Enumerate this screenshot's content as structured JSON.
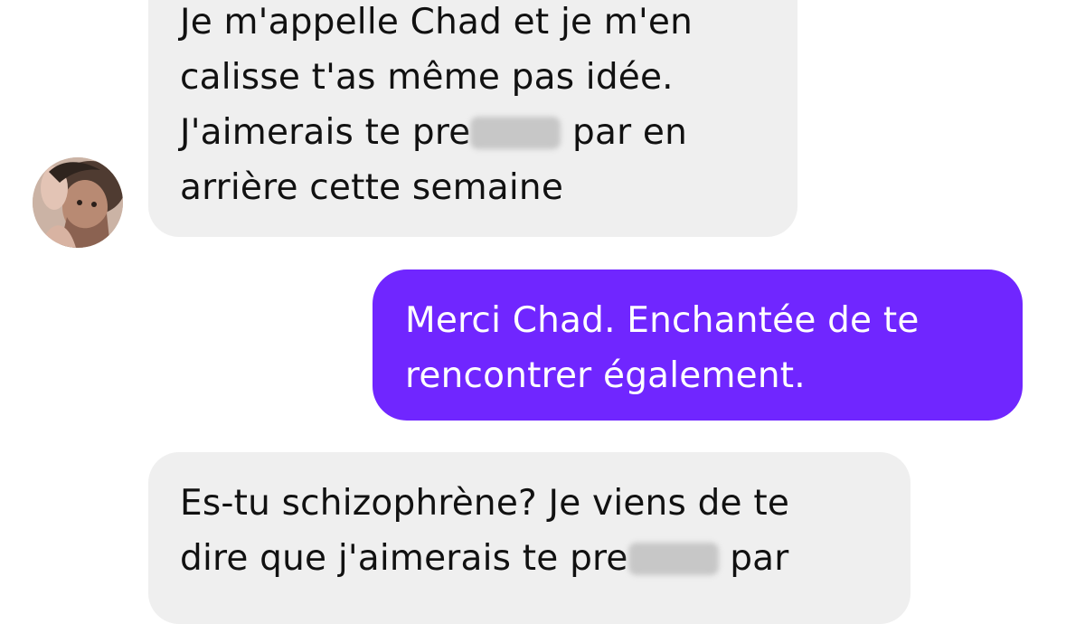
{
  "theme": {
    "incoming_bubble_color": "#efefef",
    "outgoing_bubble_color": "#7026ff",
    "redaction_color": "#c7c7c7"
  },
  "messages": [
    {
      "sender": "contact",
      "lines": [
        {
          "text": "Je m'appelle Chad et je m'en"
        },
        {
          "text": "calisse t'as même pas idée."
        },
        {
          "before": "J'aimerais te pre",
          "after": " par en"
        },
        {
          "text": "arrière cette semaine"
        }
      ]
    },
    {
      "sender": "me",
      "lines": [
        {
          "text": "Merci Chad. Enchantée de te"
        },
        {
          "text": "rencontrer également."
        }
      ]
    },
    {
      "sender": "contact",
      "lines": [
        {
          "text": "Es-tu schizophrène? Je viens de te"
        },
        {
          "before": "dire que j'aimerais te pre",
          "after": " par"
        }
      ]
    }
  ],
  "contact_avatar": {
    "icon": "profile-photo-icon"
  }
}
